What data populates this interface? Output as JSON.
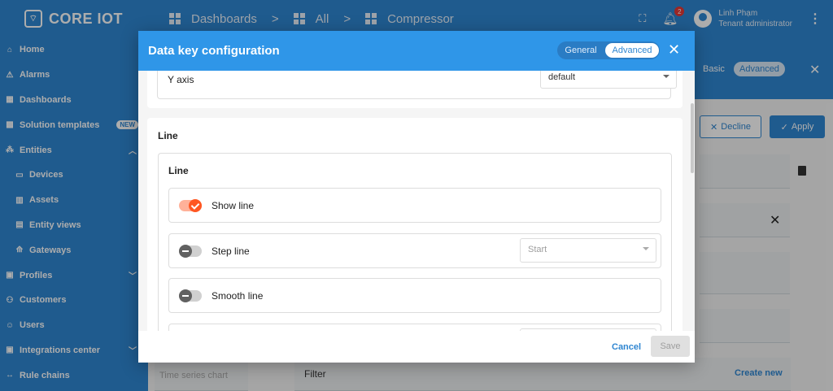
{
  "app": {
    "name": "CORE IOT"
  },
  "breadcrumb": [
    {
      "label": "Dashboards"
    },
    {
      "label": "All"
    },
    {
      "label": "Compressor"
    }
  ],
  "header": {
    "notifications": "2",
    "user_name": "Linh Phạm",
    "user_role": "Tenant administrator"
  },
  "sidebar": {
    "items": [
      {
        "label": "Home",
        "icon": "home-icon"
      },
      {
        "label": "Alarms",
        "icon": "alarm-icon"
      },
      {
        "label": "Dashboards",
        "icon": "dashboard-icon"
      },
      {
        "label": "Solution templates",
        "icon": "grid-icon",
        "badge": "NEW"
      },
      {
        "label": "Entities",
        "icon": "entities-icon"
      },
      {
        "label": "Devices",
        "icon": "device-icon"
      },
      {
        "label": "Assets",
        "icon": "asset-icon"
      },
      {
        "label": "Entity views",
        "icon": "entity-view-icon"
      },
      {
        "label": "Gateways",
        "icon": "gateway-icon"
      },
      {
        "label": "Profiles",
        "icon": "profile-icon"
      },
      {
        "label": "Customers",
        "icon": "customers-icon"
      },
      {
        "label": "Users",
        "icon": "user-icon"
      },
      {
        "label": "Integrations center",
        "icon": "integrations-icon"
      },
      {
        "label": "Rule chains",
        "icon": "rule-chain-icon"
      }
    ]
  },
  "background": {
    "toggle_basic": "Basic",
    "toggle_advanced": "Advanced",
    "decline_label": "Decline",
    "apply_label": "Apply",
    "filter_label": "Filter",
    "create_new_label": "Create new",
    "widget_label": "Time series chart"
  },
  "dialog": {
    "title": "Data key configuration",
    "tab_general": "General",
    "tab_advanced": "Advanced",
    "y_axis": {
      "label": "Y axis",
      "value": "default"
    },
    "line_section": {
      "title": "Line",
      "inner_title": "Line",
      "rows": [
        {
          "label": "Show line",
          "enabled": true
        },
        {
          "label": "Step line",
          "enabled": false,
          "select": "Start"
        },
        {
          "label": "Smooth line",
          "enabled": false
        }
      ]
    },
    "cancel_label": "Cancel",
    "save_label": "Save"
  }
}
